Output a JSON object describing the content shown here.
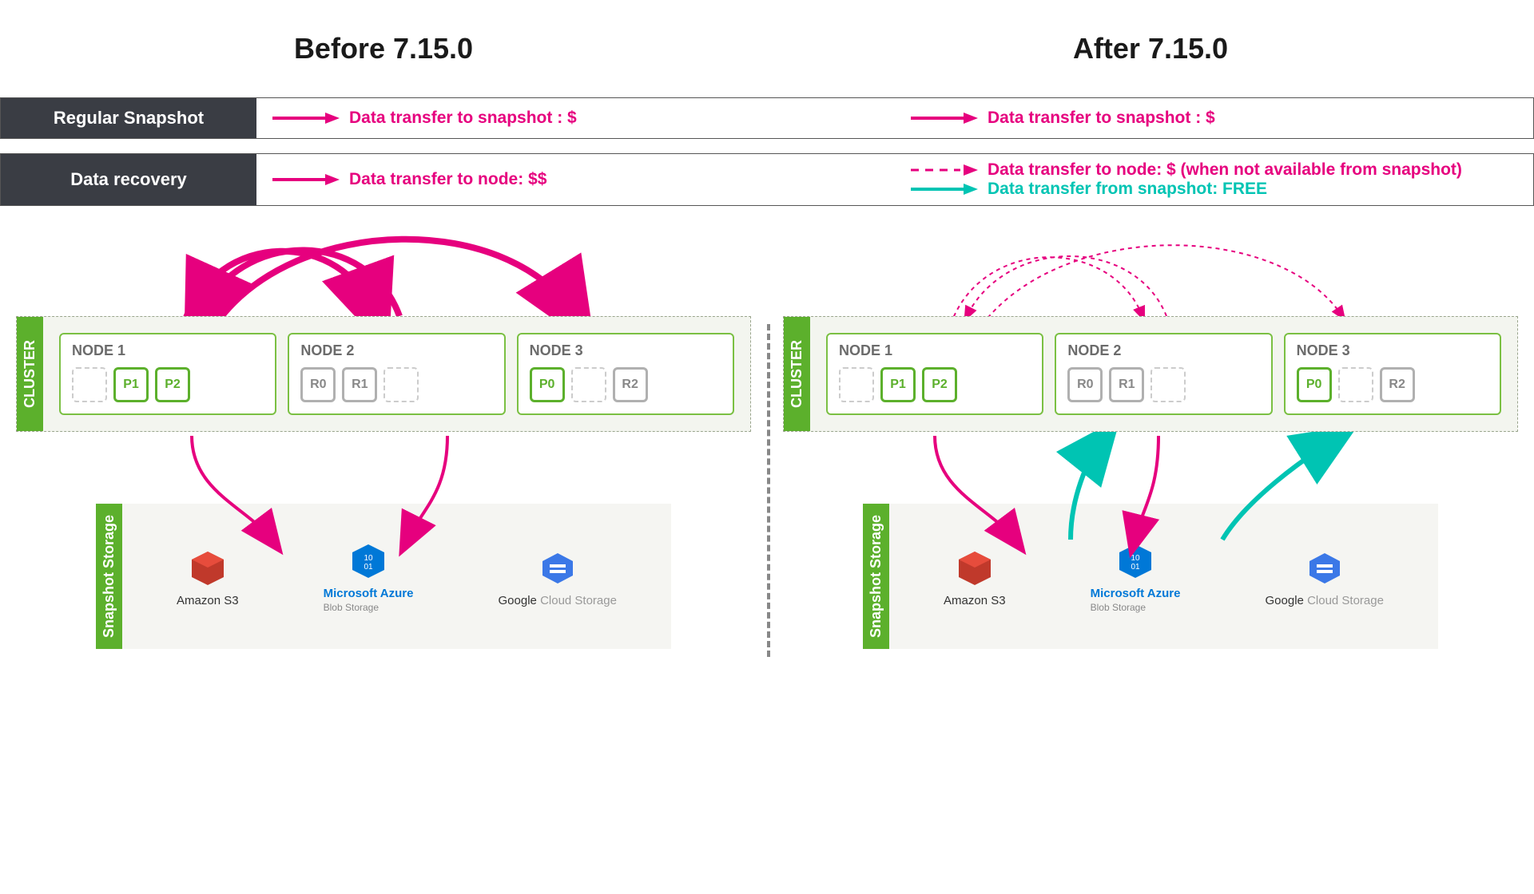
{
  "titles": {
    "before": "Before 7.15.0",
    "after": "After 7.15.0"
  },
  "legend": {
    "snapshot": {
      "label": "Regular Snapshot",
      "before": "Data transfer to snapshot : $",
      "after": "Data transfer to snapshot : $"
    },
    "recovery": {
      "label": "Data recovery",
      "before": "Data transfer to node: $$",
      "after_node": "Data transfer to node: $  (when not available from snapshot)",
      "after_snap": "Data transfer from snapshot: FREE"
    }
  },
  "labels": {
    "cluster": "CLUSTER",
    "storage": "Snapshot Storage"
  },
  "nodes": {
    "n1": {
      "title": "NODE 1",
      "shards": [
        {
          "t": "empty"
        },
        {
          "t": "primary",
          "l": "P1"
        },
        {
          "t": "primary",
          "l": "P2"
        }
      ]
    },
    "n2": {
      "title": "NODE 2",
      "shards": [
        {
          "t": "replica",
          "l": "R0"
        },
        {
          "t": "replica",
          "l": "R1"
        },
        {
          "t": "empty"
        }
      ]
    },
    "n3": {
      "title": "NODE 3",
      "shards": [
        {
          "t": "primary",
          "l": "P0"
        },
        {
          "t": "empty"
        },
        {
          "t": "replica",
          "l": "R2"
        }
      ]
    }
  },
  "providers": {
    "s3": "Amazon S3",
    "azure": {
      "line1": "Microsoft",
      "line2": "Azure",
      "sub": "Blob Storage"
    },
    "gcs": {
      "a": "Google",
      "b": "Cloud Storage"
    }
  },
  "colors": {
    "pink": "#e6007e",
    "teal": "#00c4b3",
    "green": "#5cb02c"
  }
}
